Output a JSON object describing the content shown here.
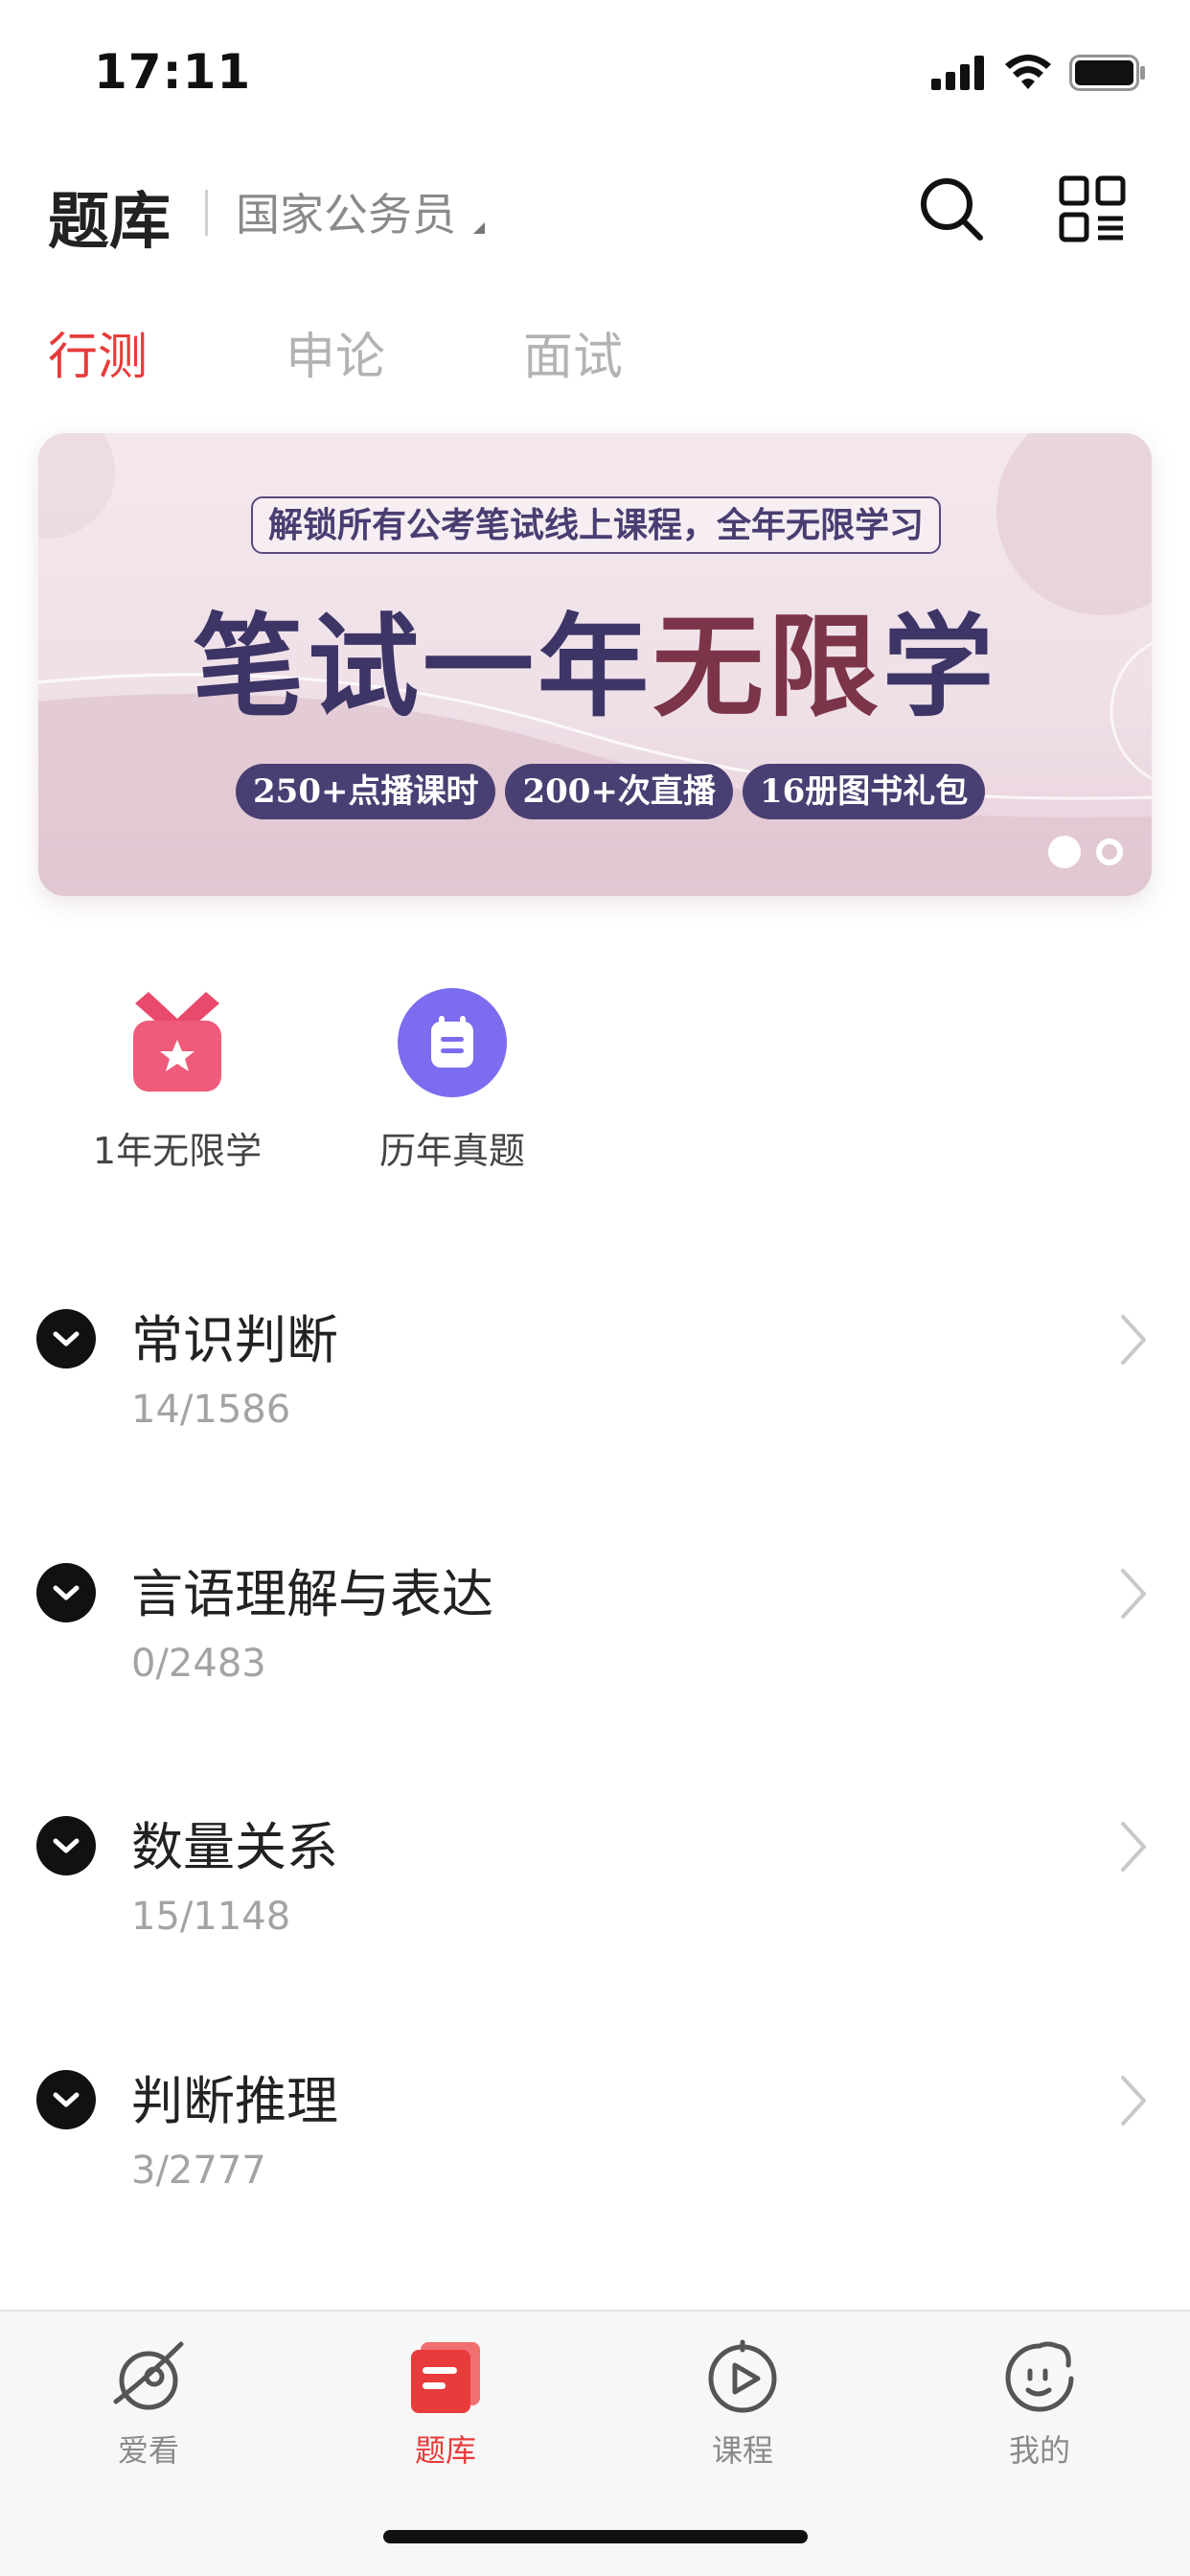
{
  "status_bar": {
    "time": "17:11"
  },
  "header": {
    "title": "题库",
    "exam_selector": "国家公务员"
  },
  "tabs": [
    {
      "label": "行测",
      "active": true
    },
    {
      "label": "申论",
      "active": false
    },
    {
      "label": "面试",
      "active": false
    }
  ],
  "banner": {
    "subtitle": "解锁所有公考笔试线上课程，全年无限学习",
    "headline_part1": "笔试一年",
    "headline_part2": "无限",
    "headline_part3": "学",
    "tags": [
      "250+点播课时",
      "200+次直播",
      "16册图书礼包"
    ],
    "page_count": 2,
    "active_page": 1
  },
  "shortcuts": [
    {
      "label": "1年无限学",
      "icon": "medal-icon",
      "color": "#ef5b7a"
    },
    {
      "label": "历年真题",
      "icon": "calendar-icon",
      "color": "#7b6cf0"
    }
  ],
  "categories": [
    {
      "title": "常识判断",
      "progress": "14/1586"
    },
    {
      "title": "言语理解与表达",
      "progress": "0/2483"
    },
    {
      "title": "数量关系",
      "progress": "15/1148"
    },
    {
      "title": "判断推理",
      "progress": "3/2777"
    }
  ],
  "bottom_nav": [
    {
      "label": "爱看",
      "icon": "explore-icon",
      "active": false
    },
    {
      "label": "题库",
      "icon": "question-bank-icon",
      "active": true
    },
    {
      "label": "课程",
      "icon": "play-course-icon",
      "active": false
    },
    {
      "label": "我的",
      "icon": "profile-face-icon",
      "active": false
    }
  ],
  "colors": {
    "accent": "#e83b3b",
    "banner_navy": "#4a3f73",
    "banner_maroon": "#7b3448"
  }
}
